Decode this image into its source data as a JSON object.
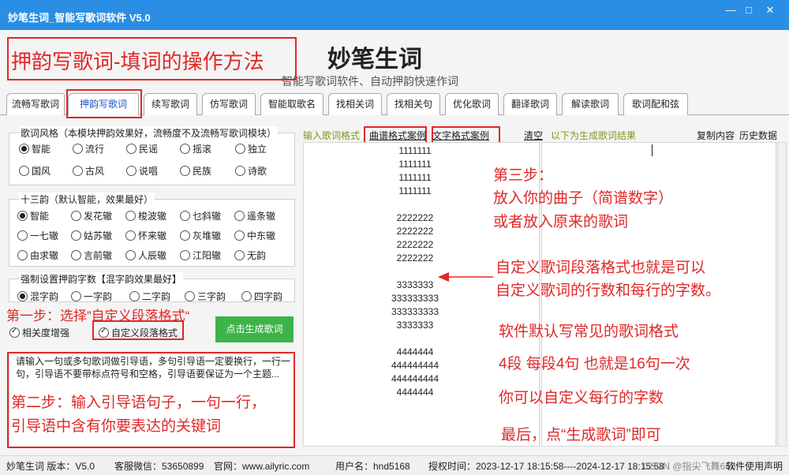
{
  "window": {
    "title": "妙笔生词_智能写歌词软件 V5.0",
    "minimize": "—",
    "maximize": "□",
    "close": "✕"
  },
  "header": {
    "title": "妙笔生词",
    "subtitle": "智能写歌词软件、自动押韵快速作词"
  },
  "tabs": [
    "流畅写歌词",
    "押韵写歌词",
    "续写歌词",
    "仿写歌词",
    "智能取歌名",
    "找相关词",
    "找相关句",
    "优化歌词",
    "翻译歌词",
    "解读歌词",
    "歌词配和弦"
  ],
  "active_tab": "押韵写歌词",
  "style_group": {
    "title": "歌词风格（本模块押韵效果好，流畅度不及流畅写歌词模块）",
    "options": [
      "智能",
      "流行",
      "民谣",
      "摇滚",
      "独立",
      "国风",
      "古风",
      "说唱",
      "民族",
      "诗歌"
    ],
    "selected": "智能"
  },
  "rhyme_group": {
    "title": "十三韵（默认智能，效果最好）",
    "options": [
      "智能",
      "发花辙",
      "梭波辙",
      "乜斜辙",
      "遥条辙",
      "一七辙",
      "姑苏辙",
      "怀来辙",
      "灰堆辙",
      "中东辙",
      "由求辙",
      "言前辙",
      "人辰辙",
      "江阳辙",
      "无韵"
    ],
    "selected": "智能"
  },
  "force_group": {
    "title": "强制设置押韵字数【混字韵效果最好】",
    "options": [
      "混字韵",
      "一字韵",
      "二字韵",
      "三字韵",
      "四字韵"
    ],
    "selected": "混字韵"
  },
  "checks": {
    "relevance": "相关度增强",
    "custom_format": "自定义段落格式"
  },
  "generate_button": "点击生成歌词",
  "prompt_text": "请输入一句或多句歌词做引导语，多句引导语一定要换行，一行一句，引导语不要带标点符号和空格，引导语要保证为一个主题...",
  "input_panel": {
    "label": "输入歌词格式",
    "link_score": "曲谱格式案例",
    "link_text": "文字格式案例",
    "clear": "清空",
    "result_hint": "以下为生成歌词结果",
    "copy": "复制内容",
    "history": "历史数据"
  },
  "format_lines": [
    "1111111",
    "1111111",
    "1111111",
    "1111111",
    "",
    "2222222",
    "2222222",
    "2222222",
    "2222222",
    "",
    "3333333",
    "333333333",
    "333333333",
    "3333333",
    "",
    "4444444",
    "444444444",
    "444444444",
    "4444444"
  ],
  "annotations": {
    "headline": "押韵写歌词-填词的操作方法",
    "step1": "第一步：选择”自定义段落格式“",
    "step2_line1": "第二步：输入引导语句子，一句一行，",
    "step2_line2": "引导语中含有你要表达的关键词",
    "step3_line1": "第三步：",
    "step3_line2": "放入你的曲子（简谱数字）",
    "step3_line3": "或者放入原来的歌词",
    "custom_line1": "自定义歌词段落格式也就是可以",
    "custom_line2": "自定义歌词的行数和每行的字数。",
    "default_line": "软件默认写常见的歌词格式",
    "default_detail": "4段 每段4句  也就是16句一次",
    "custom_chars": "你可以自定义每行的字数",
    "final": "最后，点“生成歌词”即可"
  },
  "status": {
    "app": "妙笔生词 版本：V5.0",
    "wechat": "客服微信：53650899",
    "website": "官网：www.ailyric.com",
    "user": "用户名：hnd5168",
    "auth": "授权时间：2023-12-17 18:15:58----2024-12-17 18:15:58",
    "watermark": "CSDN @指尖飞舞666",
    "manual": "软件使用声明"
  },
  "colors": {
    "titlebar": "#2a8ee4",
    "annotation": "#e02828",
    "generate": "#3cb44a",
    "active_tab": "#1a56c8",
    "hint_green": "#7a9a1a"
  }
}
